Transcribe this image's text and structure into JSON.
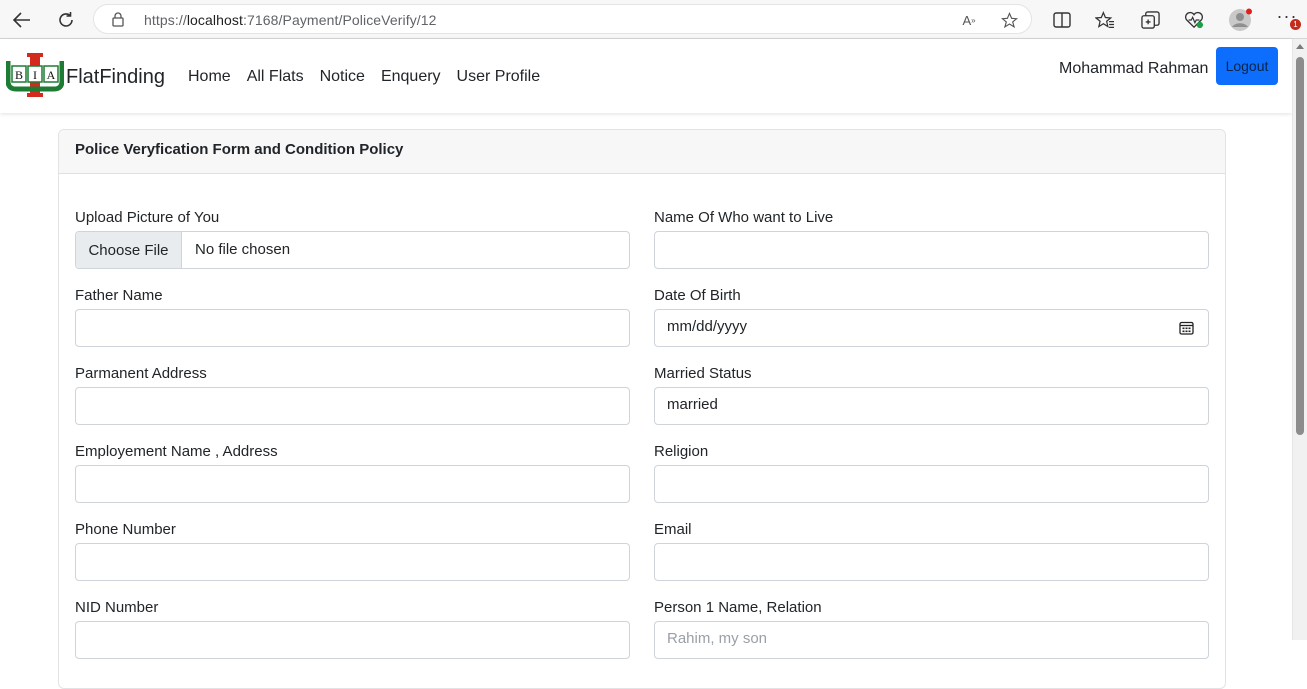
{
  "browser": {
    "url_prefix": "https://",
    "url_host": "localhost",
    "url_rest": ":7168/Payment/PoliceVerify/12",
    "read_aloud_label": "A",
    "notification_badge": "1"
  },
  "navbar": {
    "brand": "FlatFinding",
    "links": [
      "Home",
      "All Flats",
      "Notice",
      "Enquery",
      "User Profile"
    ],
    "user_name": "Mohammad Rahman",
    "logout_label": "Logout",
    "logo_letters": [
      "B",
      "I",
      "A"
    ]
  },
  "card": {
    "title": "Police Veryfication Form and Condition Policy"
  },
  "form": {
    "upload": {
      "label": "Upload Picture of You",
      "button": "Choose File",
      "status": "No file chosen"
    },
    "name_live": {
      "label": "Name Of Who want to Live",
      "value": ""
    },
    "father": {
      "label": "Father Name",
      "value": ""
    },
    "dob": {
      "label": "Date Of Birth",
      "value": "mm/dd/yyyy"
    },
    "address": {
      "label": "Parmanent Address",
      "value": ""
    },
    "married": {
      "label": "Married Status",
      "value": "married"
    },
    "employment": {
      "label": "Employement Name , Address",
      "value": ""
    },
    "religion": {
      "label": "Religion",
      "value": ""
    },
    "phone": {
      "label": "Phone Number",
      "value": ""
    },
    "email": {
      "label": "Email",
      "value": ""
    },
    "nid": {
      "label": "NID Number",
      "value": ""
    },
    "person1": {
      "label": "Person 1 Name, Relation",
      "placeholder": "Rahim, my son"
    }
  },
  "colors": {
    "primary": "#0d6efd",
    "logo_green": "#1e7b34",
    "logo_red": "#d42a1e"
  }
}
